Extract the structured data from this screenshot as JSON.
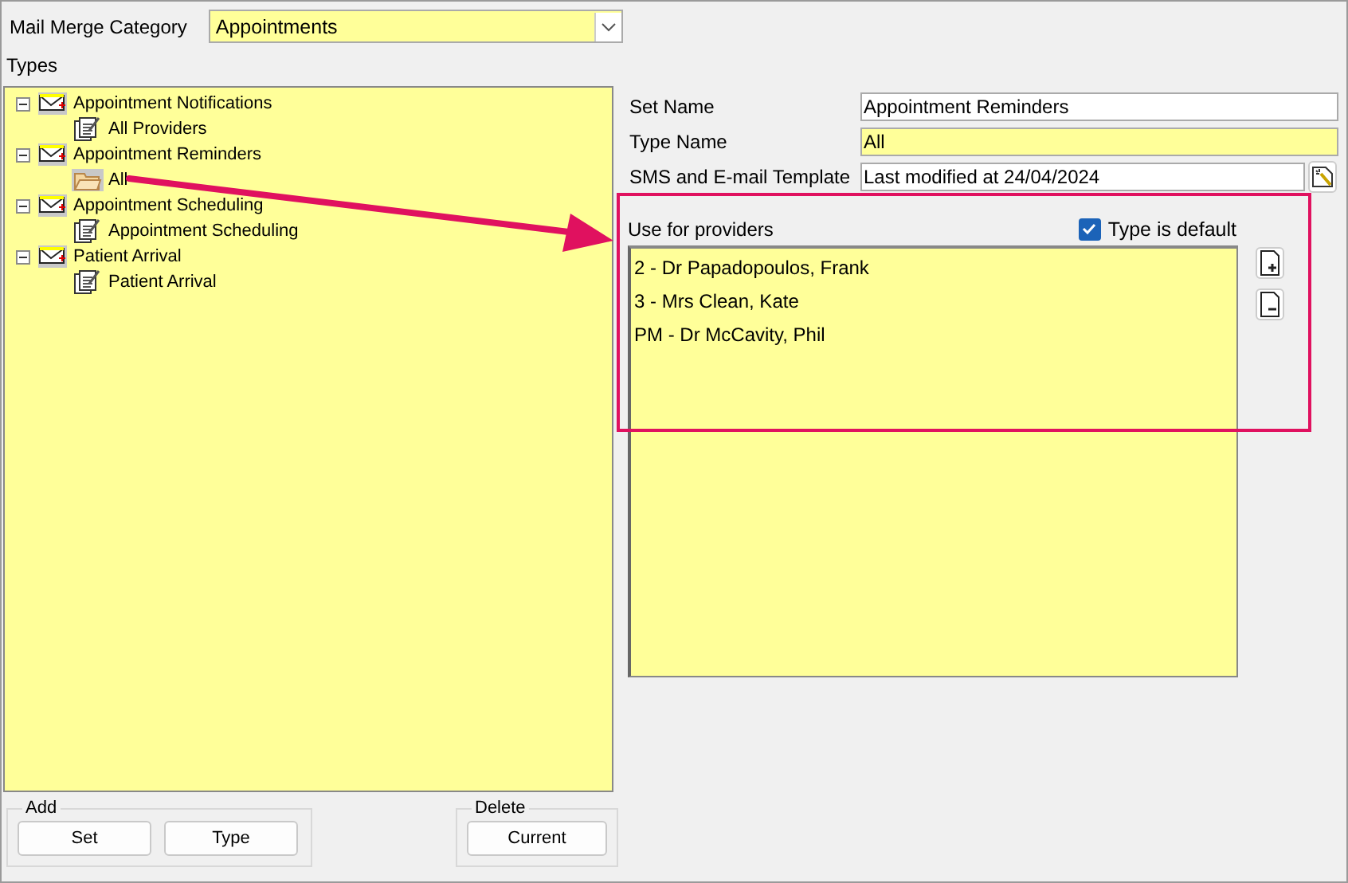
{
  "category": {
    "label": "Mail Merge Category",
    "value": "Appointments"
  },
  "types_label": "Types",
  "tree": [
    {
      "label": "Appointment Notifications",
      "expanded": true,
      "children": [
        {
          "label": "All Providers",
          "selected": false
        }
      ]
    },
    {
      "label": "Appointment Reminders",
      "expanded": true,
      "children": [
        {
          "label": "All",
          "selected": true
        }
      ]
    },
    {
      "label": "Appointment Scheduling",
      "expanded": true,
      "children": [
        {
          "label": "Appointment Scheduling",
          "selected": false
        }
      ]
    },
    {
      "label": "Patient Arrival",
      "expanded": true,
      "children": [
        {
          "label": "Patient Arrival",
          "selected": false
        }
      ]
    }
  ],
  "fields": [
    {
      "label": "Set Name",
      "value": "Appointment Reminders",
      "highlighted": false
    },
    {
      "label": "Type Name",
      "value": "All",
      "highlighted": true
    },
    {
      "label": "SMS and E-mail Template",
      "value": "Last modified at 24/04/2024",
      "highlighted": false
    }
  ],
  "providers_label": "Use for providers",
  "type_default": {
    "label": "Type is default",
    "checked": true
  },
  "providers": [
    "2 - Dr Papadopoulos, Frank",
    "3 - Mrs Clean, Kate",
    "PM - Dr McCavity, Phil"
  ],
  "add_group": {
    "title": "Add",
    "buttons": [
      "Set",
      "Type"
    ]
  },
  "delete_group": {
    "title": "Delete",
    "buttons": [
      "Current"
    ]
  }
}
